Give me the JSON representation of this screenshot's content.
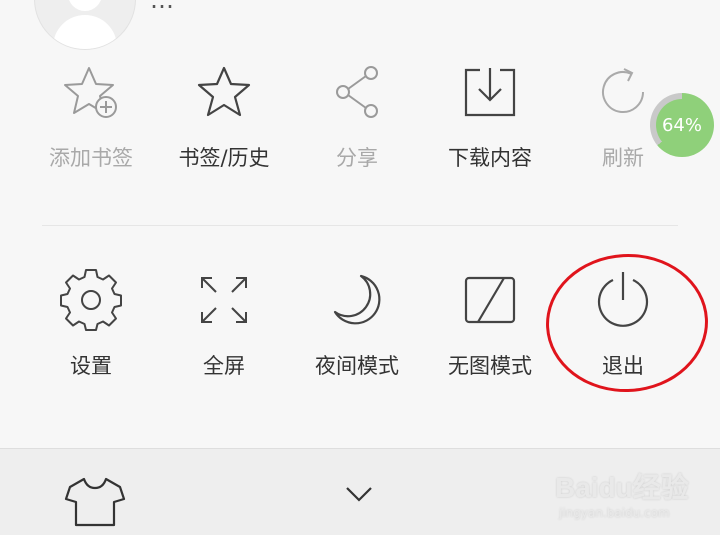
{
  "top": {
    "partial_text": "…"
  },
  "menu_row_1": [
    {
      "label": "添加书签",
      "icon": "star-add-icon",
      "dim": true
    },
    {
      "label": "书签/历史",
      "icon": "star-icon",
      "dim": false
    },
    {
      "label": "分享",
      "icon": "share-icon",
      "dim": true
    },
    {
      "label": "下载内容",
      "icon": "download-icon",
      "dim": false
    },
    {
      "label": "刷新",
      "icon": "refresh-icon",
      "dim": true
    }
  ],
  "menu_row_2": [
    {
      "label": "设置",
      "icon": "gear-icon"
    },
    {
      "label": "全屏",
      "icon": "fullscreen-icon"
    },
    {
      "label": "夜间模式",
      "icon": "moon-icon"
    },
    {
      "label": "无图模式",
      "icon": "no-image-icon"
    },
    {
      "label": "退出",
      "icon": "power-icon"
    }
  ],
  "progress": {
    "text": "64%",
    "value": 0.64,
    "color": "#8fd07a"
  },
  "annotation": {
    "color": "#e0141c",
    "target": "退出"
  },
  "bottom_bar": {
    "left_icon": "shirt-icon",
    "center_icon": "chevron-down-icon"
  },
  "watermark": {
    "main": "Baidu经验",
    "sub": "jingyan.baidu.com"
  }
}
